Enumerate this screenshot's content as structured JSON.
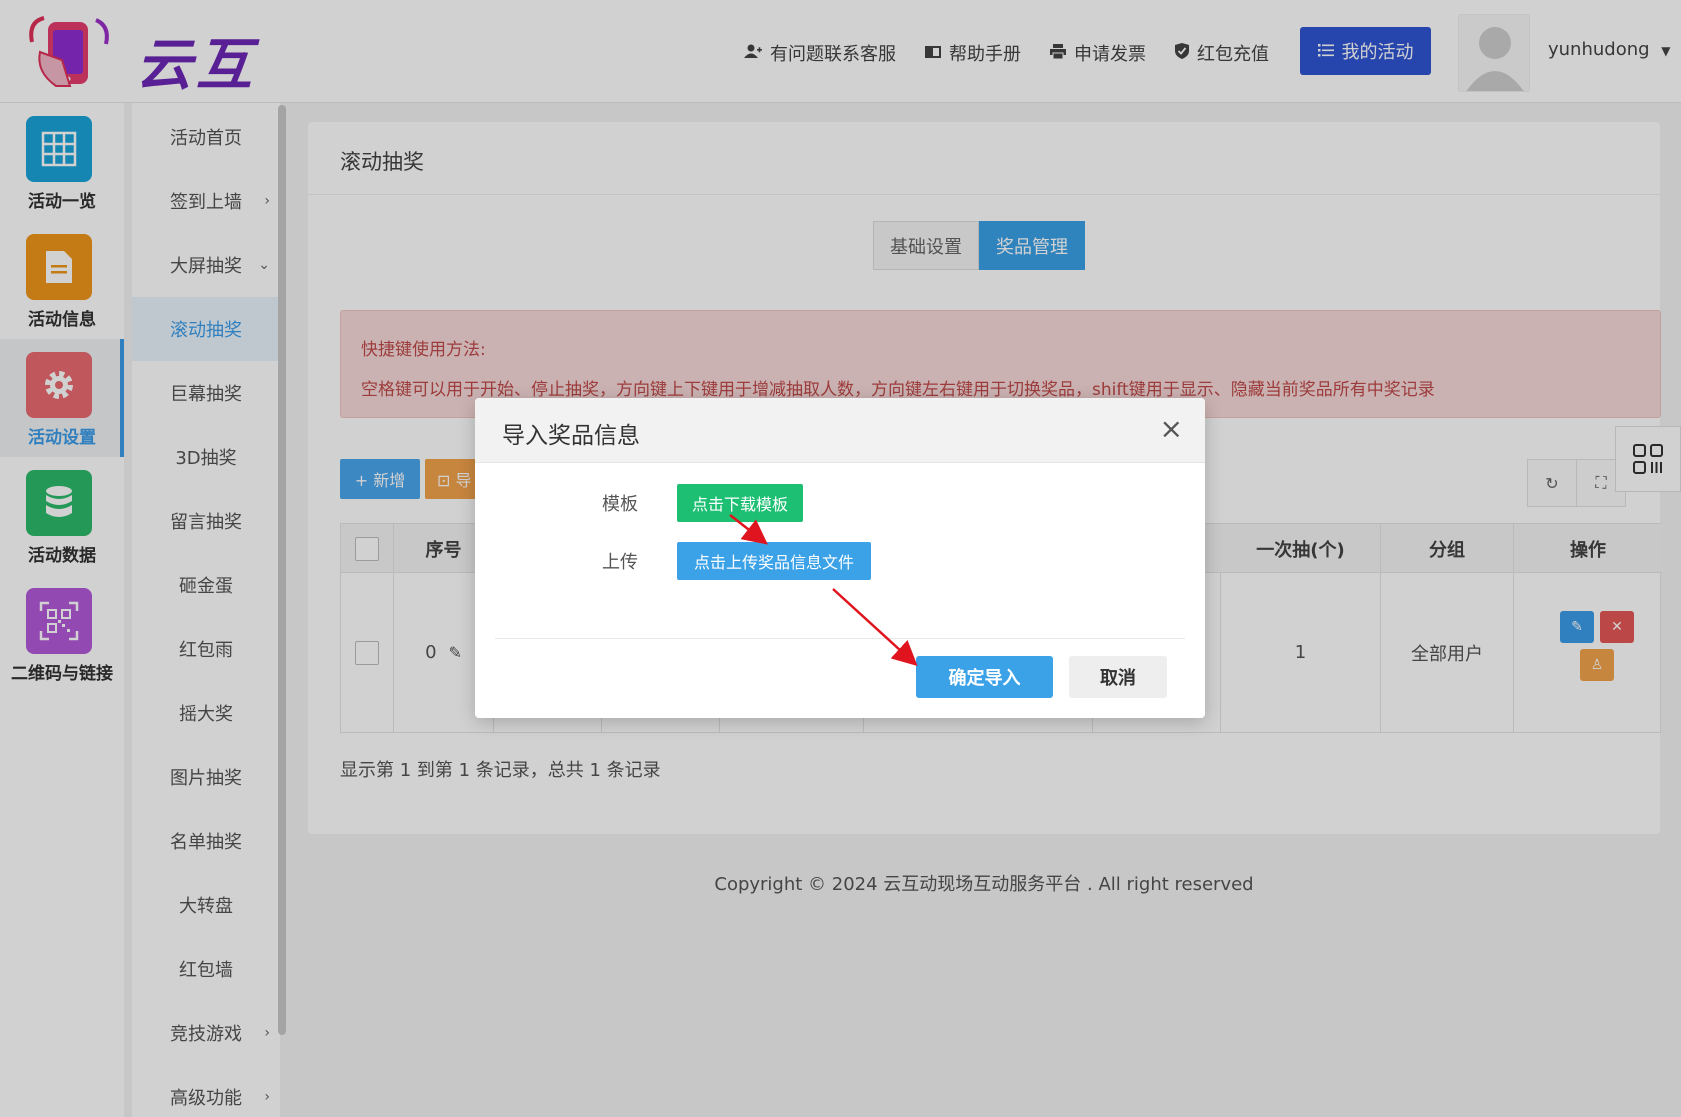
{
  "header": {
    "logo_text": "云互动",
    "links": [
      {
        "label": "有问题联系客服",
        "icon": "user-plus-icon"
      },
      {
        "label": "帮助手册",
        "icon": "book-icon"
      },
      {
        "label": "申请发票",
        "icon": "printer-icon"
      },
      {
        "label": "红包充值",
        "icon": "shield-check-icon"
      }
    ],
    "my_activity": "我的活动",
    "username": "yunhudong"
  },
  "iconbar": [
    {
      "label": "活动一览",
      "color": "#1aa3d9",
      "icon": "grid-icon"
    },
    {
      "label": "活动信息",
      "color": "#f0961b",
      "icon": "document-icon"
    },
    {
      "label": "活动设置",
      "color": "#ea6b72",
      "icon": "gear-icon"
    },
    {
      "label": "活动数据",
      "color": "#2dbb6b",
      "icon": "database-icon"
    },
    {
      "label": "二维码与链接",
      "color": "#b259d9",
      "icon": "qrcode-icon"
    }
  ],
  "submenu": [
    {
      "label": "活动首页"
    },
    {
      "label": "签到上墙",
      "chevron": "›"
    },
    {
      "label": "大屏抽奖",
      "chevron": "⌄"
    },
    {
      "label": "滚动抽奖"
    },
    {
      "label": "巨幕抽奖"
    },
    {
      "label": "3D抽奖"
    },
    {
      "label": "留言抽奖"
    },
    {
      "label": "砸金蛋"
    },
    {
      "label": "红包雨"
    },
    {
      "label": "摇大奖"
    },
    {
      "label": "图片抽奖"
    },
    {
      "label": "名单抽奖"
    },
    {
      "label": "大转盘"
    },
    {
      "label": "红包墙"
    },
    {
      "label": "竞技游戏",
      "chevron": "›"
    },
    {
      "label": "高级功能",
      "chevron": "›"
    }
  ],
  "panel": {
    "title": "滚动抽奖",
    "tabs": [
      "基础设置",
      "奖品管理"
    ],
    "alert_title": "快捷键使用方法:",
    "alert_text": "空格键可以用于开始、停止抽奖，方向键上下键用于增减抽取人数，方向键左右键用于切换奖品，shift键用于显示、隐藏当前奖品所有中奖记录",
    "add_button": "+ 新增",
    "import_button": "⊡ 导",
    "table": {
      "headers": [
        "序号",
        "一次抽(个)",
        "分组",
        "操作"
      ],
      "row": {
        "index": "0",
        "draw_count": "1",
        "group": "全部用户"
      }
    },
    "page_info": "显示第 1 到第 1 条记录，总共 1 条记录"
  },
  "copyright": "Copyright © 2024 云互动现场互动服务平台 . All right reserved",
  "modal": {
    "title": "导入奖品信息",
    "template_label": "模板",
    "download_button": "点击下载模板",
    "upload_label": "上传",
    "upload_button": "点击上传奖品信息文件",
    "confirm_button": "确定导入",
    "cancel_button": "取消"
  }
}
